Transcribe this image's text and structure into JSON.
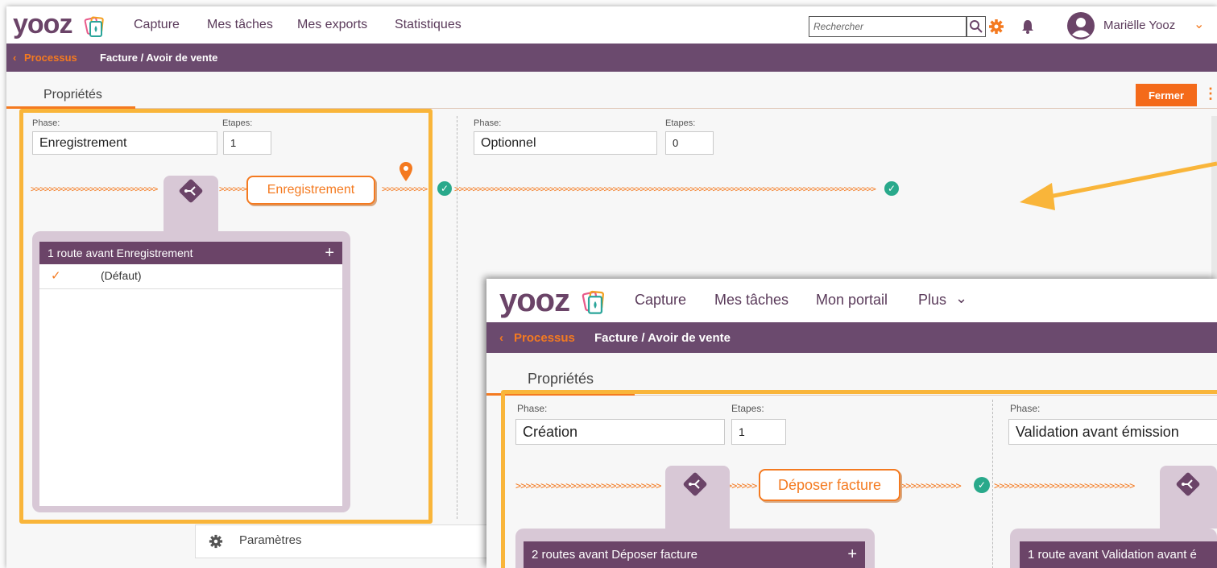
{
  "main": {
    "logo": "yooz",
    "nav": [
      "Capture",
      "Mes tâches",
      "Mes exports",
      "Statistiques"
    ],
    "search_placeholder": "Rechercher",
    "user_name": "Mariëlle Yooz",
    "breadcrumb_back": "Processus",
    "breadcrumb_current": "Facture / Avoir de vente",
    "tab": "Propriétés",
    "close_button": "Fermer",
    "phase_label": "Phase:",
    "steps_label": "Etapes:",
    "phase1_name": "Enregistrement",
    "phase1_steps": "1",
    "phase2_name": "Optionnel",
    "phase2_steps": "0",
    "step_pill": "Enregistrement",
    "route_header": "1 route avant Enregistrement",
    "route_item": "(Défaut)",
    "settings_label": "Paramètres",
    "accent_color": "#f47a20",
    "brand_color": "#6b4468"
  },
  "inset": {
    "logo": "yooz",
    "nav": [
      "Capture",
      "Mes tâches",
      "Mon portail",
      "Plus"
    ],
    "breadcrumb_back": "Processus",
    "breadcrumb_current": "Facture / Avoir de vente",
    "tab": "Propriétés",
    "phase_label": "Phase:",
    "steps_label": "Etapes:",
    "phase1_name": "Création",
    "phase1_steps": "1",
    "phase2_name": "Validation avant émission",
    "step_pill": "Déposer facture",
    "route1_header": "2 routes avant Déposer facture",
    "route2_header": "1 route avant Validation avant é"
  }
}
